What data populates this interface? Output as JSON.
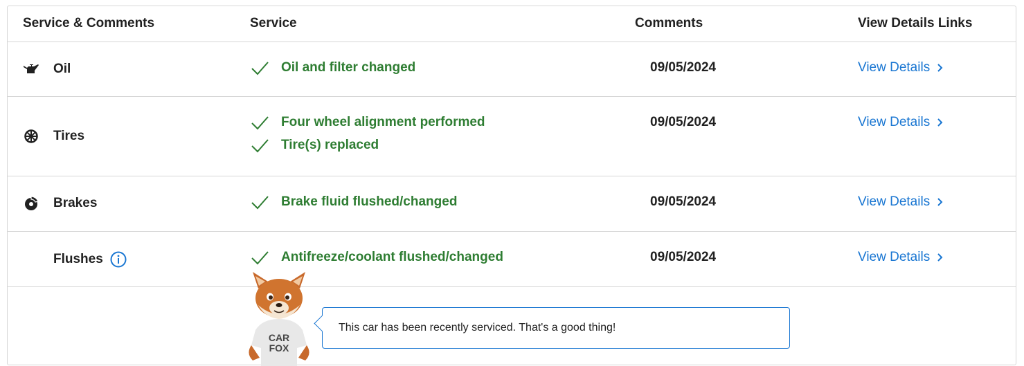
{
  "header": {
    "col1": "Service & Comments",
    "col2": "Service",
    "col3": "Comments",
    "col4": "View Details Links"
  },
  "rows": [
    {
      "category": "Oil",
      "icon": "oil-can-icon",
      "services": [
        "Oil and filter changed"
      ],
      "date": "09/05/2024",
      "link": "View Details"
    },
    {
      "category": "Tires",
      "icon": "tire-icon",
      "services": [
        "Four wheel alignment performed",
        "Tire(s) replaced"
      ],
      "date": "09/05/2024",
      "link": "View Details"
    },
    {
      "category": "Brakes",
      "icon": "brake-disc-icon",
      "services": [
        "Brake fluid flushed/changed"
      ],
      "date": "09/05/2024",
      "link": "View Details"
    },
    {
      "category": "Flushes",
      "icon": "info-icon",
      "services": [
        "Antifreeze/coolant flushed/changed"
      ],
      "date": "09/05/2024",
      "link": "View Details"
    }
  ],
  "footer": {
    "message": "This car has been recently serviced. That's a good thing!",
    "mascot_shirt_line1": "CAR",
    "mascot_shirt_line2": "FOX"
  },
  "colors": {
    "service_green": "#2e7d32",
    "link_blue": "#1976d2",
    "border": "#d6d6d6"
  }
}
